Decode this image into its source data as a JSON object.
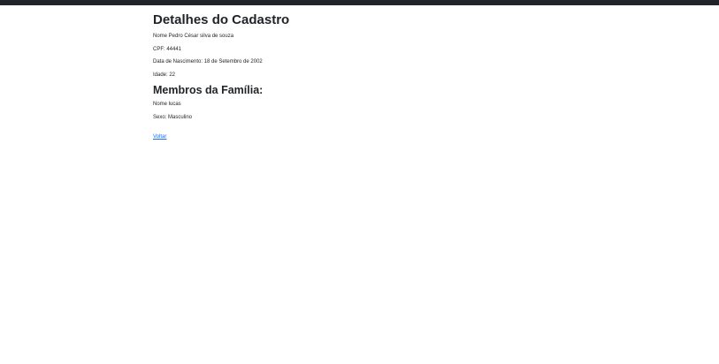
{
  "page": {
    "title": "Detalhes do Cadastro",
    "fields": {
      "name": "Nome Pedro César silva de souza",
      "cpf": "CPF: 44441",
      "birthdate": "Data de Nascimento: 18 de Setembro de 2002",
      "age": "Idade: 22"
    },
    "family_title": "Membros da Família:",
    "family": [
      {
        "name": "Nome lucas",
        "sex": "Sexo: Masculino"
      }
    ],
    "back_link": "Voltar"
  }
}
